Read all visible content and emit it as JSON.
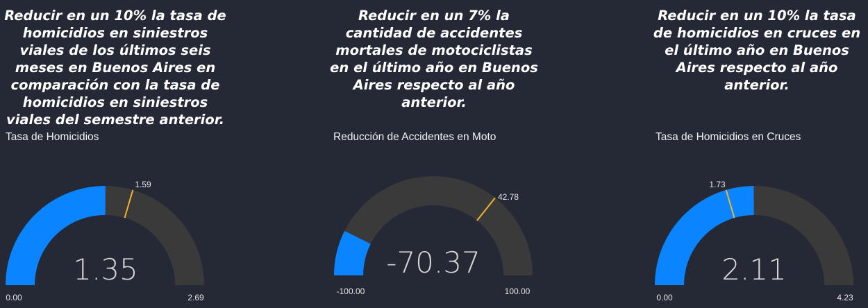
{
  "colors": {
    "fill": "#0a84ff",
    "track": "#3b3a3a",
    "target": "#f0b42a",
    "background": "#252936"
  },
  "chart_data": [
    {
      "type": "gauge",
      "goal_text": "Reducir en un 10% la tasa de homicidios en siniestros viales de los últimos seis meses en Buenos Aires en comparación con la tasa de homicidios en siniestros viales del semestre anterior.",
      "title": "Tasa de Homicidios",
      "min": 0,
      "max": 2.69,
      "value": 1.35,
      "target": 1.59,
      "labels": {
        "min": "0.00",
        "max": "2.69",
        "value": "1.35",
        "target": "1.59"
      }
    },
    {
      "type": "gauge",
      "goal_text": "Reducir en un 7% la cantidad de accidentes mortales de motociclistas en el último año en Buenos Aires respecto al año anterior.",
      "title": "Reducción de Accidentes en Moto",
      "min": -100,
      "max": 100,
      "value": -70.37,
      "target": 42.78,
      "labels": {
        "min": "-100.00",
        "max": "100.00",
        "value": "-70.37",
        "target": "42.78"
      }
    },
    {
      "type": "gauge",
      "goal_text": "Reducir en un 10% la  tasa de homicidios en cruces en el último año en Buenos Aires respecto al año anterior.",
      "title": "Tasa de Homicidios en Cruces",
      "min": 0,
      "max": 4.23,
      "value": 2.11,
      "target": 1.73,
      "labels": {
        "min": "0.00",
        "max": "4.23",
        "value": "2.11",
        "target": "1.73"
      }
    }
  ]
}
